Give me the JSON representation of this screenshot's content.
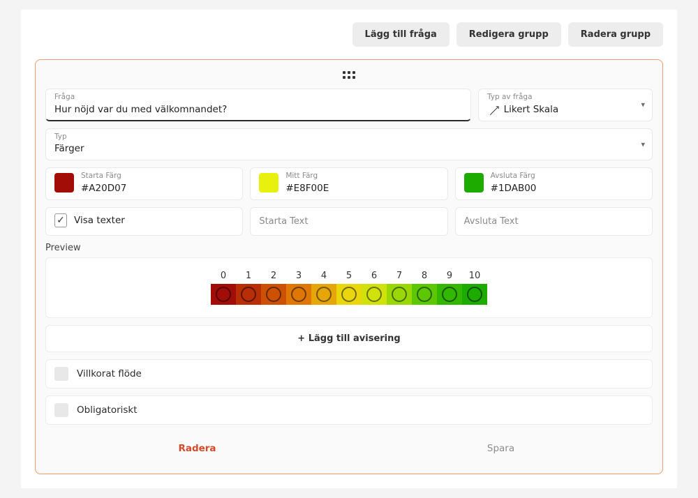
{
  "topbar": {
    "add": "Lägg till fråga",
    "edit": "Redigera grupp",
    "delete": "Radera grupp"
  },
  "question": {
    "label": "Fråga",
    "value": "Hur nöjd var du med välkomnandet?"
  },
  "qtype": {
    "label": "Typ av fråga",
    "value": "Likert Skala"
  },
  "type": {
    "label": "Typ",
    "value": "Färger"
  },
  "startColor": {
    "label": "Starta Färg",
    "value": "#A20D07",
    "hex": "#a20d07"
  },
  "midColor": {
    "label": "Mitt Färg",
    "value": "#E8F00E",
    "hex": "#e8f00e"
  },
  "endColor": {
    "label": "Avsluta Färg",
    "value": "#1DAB00",
    "hex": "#1dab00"
  },
  "showTexts": "Visa texter",
  "startText": "Starta Text",
  "endText": "Avsluta Text",
  "previewLabel": "Preview",
  "addAlert": "+  Lägg till avisering",
  "conditional": "Villkorat flöde",
  "mandatory": "Obligatoriskt",
  "deleteBtn": "Radera",
  "saveBtn": "Spara",
  "chart_data": {
    "type": "bar",
    "categories": [
      0,
      1,
      2,
      3,
      4,
      5,
      6,
      7,
      8,
      9,
      10
    ],
    "values": [
      0,
      1,
      2,
      3,
      4,
      5,
      6,
      7,
      8,
      9,
      10
    ],
    "title": "",
    "xlabel": "",
    "ylabel": "",
    "ylim": [
      0,
      10
    ],
    "colors": [
      "#a20d07",
      "#b72e07",
      "#cd5105",
      "#df7706",
      "#e6a609",
      "#e9d60c",
      "#d1e20b",
      "#99d707",
      "#5cc703",
      "#33b701",
      "#1dab00"
    ]
  }
}
